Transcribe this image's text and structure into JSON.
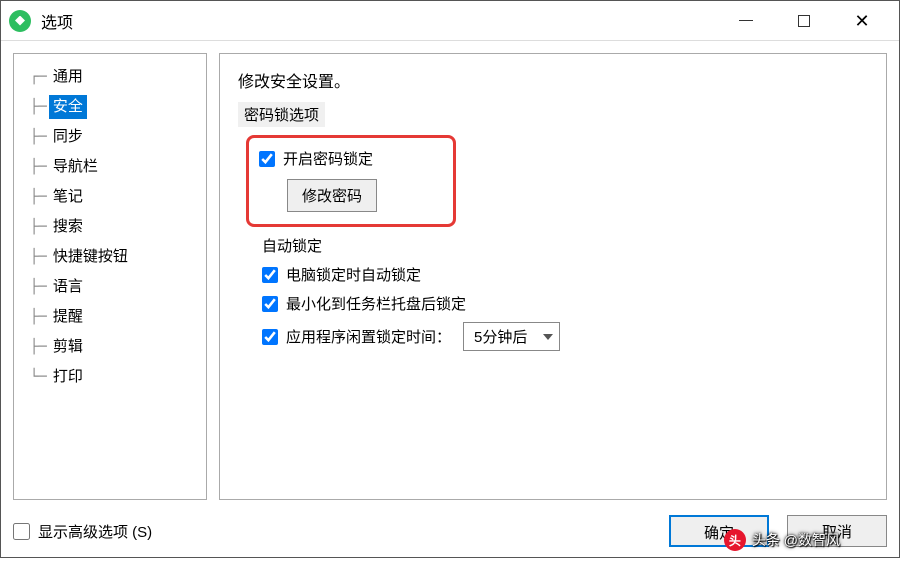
{
  "titlebar": {
    "title": "选项"
  },
  "sidebar": {
    "items": [
      {
        "label": "通用",
        "selected": false
      },
      {
        "label": "安全",
        "selected": true
      },
      {
        "label": "同步",
        "selected": false
      },
      {
        "label": "导航栏",
        "selected": false
      },
      {
        "label": "笔记",
        "selected": false
      },
      {
        "label": "搜索",
        "selected": false
      },
      {
        "label": "快捷键按钮",
        "selected": false
      },
      {
        "label": "语言",
        "selected": false
      },
      {
        "label": "提醒",
        "selected": false
      },
      {
        "label": "剪辑",
        "selected": false
      },
      {
        "label": "打印",
        "selected": false
      }
    ]
  },
  "content": {
    "heading": "修改安全设置。",
    "group_label": "密码锁选项",
    "enable_lock": {
      "label": "开启密码锁定",
      "checked": true
    },
    "change_password_btn": "修改密码",
    "auto_lock_label": "自动锁定",
    "lock_on_computer_lock": {
      "label": "电脑锁定时自动锁定",
      "checked": true
    },
    "lock_on_minimize": {
      "label": "最小化到任务栏托盘后锁定",
      "checked": true
    },
    "idle_lock": {
      "label": "应用程序闲置锁定时间：",
      "checked": true
    },
    "idle_select": {
      "value": "5分钟后"
    }
  },
  "footer": {
    "show_advanced": "显示高级选项 (S)",
    "ok": "确定",
    "cancel": "取消"
  },
  "watermark": {
    "text": "头条 @数智风"
  }
}
